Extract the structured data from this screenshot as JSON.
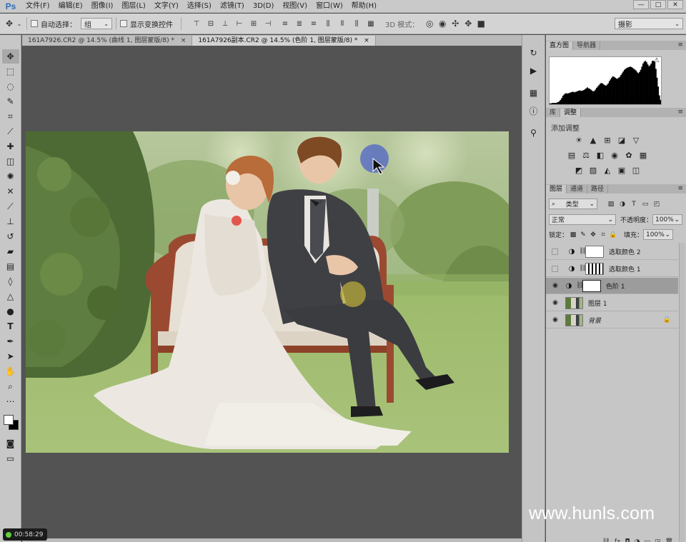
{
  "app": {
    "logo": "Ps",
    "menu": [
      "文件(F)",
      "编辑(E)",
      "图像(I)",
      "图层(L)",
      "文字(Y)",
      "选择(S)",
      "滤镜(T)",
      "3D(D)",
      "视图(V)",
      "窗口(W)",
      "帮助(H)"
    ],
    "window_controls": [
      "—",
      "□",
      "✕"
    ]
  },
  "options": {
    "auto_select_label": "自动选择：",
    "auto_select_value": "组",
    "show_transform_label": "显示变换控件",
    "mode_3d_label": "3D 模式：",
    "workspace": "摄影"
  },
  "tabs": [
    {
      "label": "161A7926.CR2 @ 14.5% (曲线 1, 图层蒙版/8) *",
      "close": "×"
    },
    {
      "label": "161A7926副本.CR2 @ 14.5% (色阶 1, 图层蒙版/8) *",
      "close": "×"
    }
  ],
  "status": {
    "timer": "00:58:29",
    "watermark": "www.hunls.com"
  },
  "panels": {
    "histogram_tabs": [
      "直方图",
      "导航器"
    ],
    "histogram_warning": "⚠",
    "adjust_tabs": [
      "库",
      "调整"
    ],
    "adjust_title": "添加调整",
    "layers_tabs": [
      "图层",
      "通道",
      "路径"
    ],
    "filter_kind": "类型",
    "blend_mode": "正常",
    "opacity_label": "不透明度：",
    "opacity_value": "100%",
    "lock_label": "锁定：",
    "fill_label": "填充：",
    "fill_value": "100%"
  },
  "layers": [
    {
      "name": "选取颜色 2",
      "visible": false
    },
    {
      "name": "选取颜色 1",
      "visible": false
    },
    {
      "name": "色阶 1",
      "visible": true,
      "selected": true
    },
    {
      "name": "图层 1",
      "visible": true
    },
    {
      "name": "背景",
      "visible": true,
      "locked": true
    }
  ],
  "histogram": [
    2,
    2,
    3,
    3,
    3,
    3,
    4,
    5,
    7,
    10,
    14,
    19,
    22,
    24,
    25,
    24,
    25,
    26,
    27,
    28,
    28,
    27,
    28,
    29,
    30,
    31,
    31,
    30,
    31,
    32,
    34,
    36,
    38,
    36,
    35,
    33,
    31,
    29,
    30,
    33,
    37,
    40,
    43,
    46,
    48,
    47,
    45,
    43,
    42,
    44,
    47,
    52,
    56,
    60,
    63,
    62,
    60,
    58,
    58,
    60,
    62,
    66,
    70,
    74,
    78,
    80,
    82,
    83,
    84,
    85,
    84,
    82,
    80,
    78,
    76,
    72,
    70,
    73,
    78,
    85,
    92,
    96,
    98,
    95,
    90,
    86,
    88,
    92,
    98,
    98,
    96,
    80,
    60,
    40,
    20,
    10
  ],
  "colors": {
    "panel_bg": "#c6c6c6",
    "canvas_bg": "#535353",
    "ps_blue": "#2d6fb8"
  }
}
